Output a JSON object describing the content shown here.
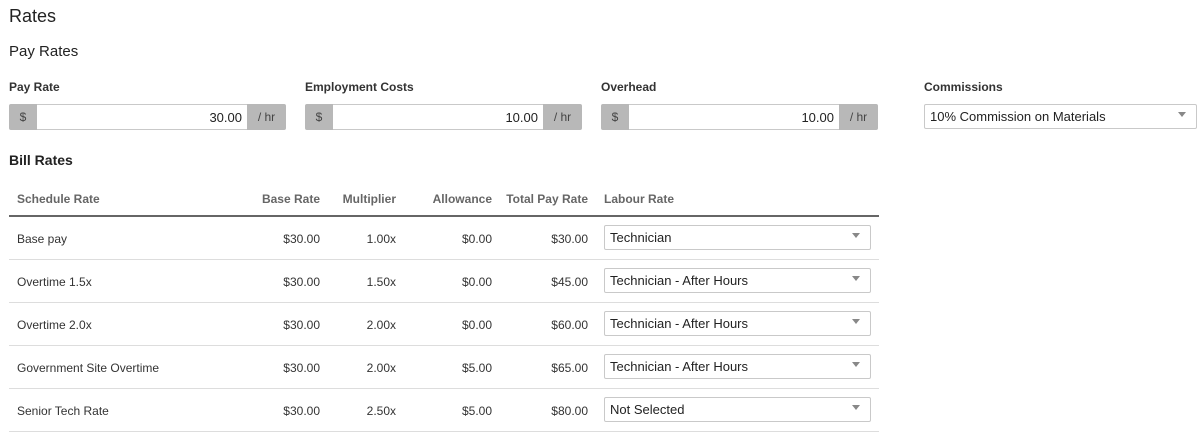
{
  "page": {
    "title": "Rates"
  },
  "pay_rates": {
    "heading": "Pay Rates",
    "pay_rate": {
      "label": "Pay Rate",
      "prefix": "$",
      "value": "30.00",
      "suffix": "/ hr"
    },
    "employment_costs": {
      "label": "Employment Costs",
      "prefix": "$",
      "value": "10.00",
      "suffix": "/ hr"
    },
    "overhead": {
      "label": "Overhead",
      "prefix": "$",
      "value": "10.00",
      "suffix": "/ hr"
    },
    "commissions": {
      "label": "Commissions",
      "selected": "10% Commission on Materials"
    }
  },
  "bill_rates": {
    "heading": "Bill Rates",
    "columns": {
      "schedule_rate": "Schedule Rate",
      "base_rate": "Base Rate",
      "multiplier": "Multiplier",
      "allowance": "Allowance",
      "total_pay_rate": "Total Pay Rate",
      "labour_rate": "Labour Rate"
    },
    "rows": [
      {
        "schedule_rate": "Base pay",
        "base_rate": "$30.00",
        "multiplier": "1.00x",
        "allowance": "$0.00",
        "total_pay_rate": "$30.00",
        "labour_rate": "Technician"
      },
      {
        "schedule_rate": "Overtime 1.5x",
        "base_rate": "$30.00",
        "multiplier": "1.50x",
        "allowance": "$0.00",
        "total_pay_rate": "$45.00",
        "labour_rate": "Technician - After Hours"
      },
      {
        "schedule_rate": "Overtime 2.0x",
        "base_rate": "$30.00",
        "multiplier": "2.00x",
        "allowance": "$0.00",
        "total_pay_rate": "$60.00",
        "labour_rate": "Technician - After Hours"
      },
      {
        "schedule_rate": "Government Site Overtime",
        "base_rate": "$30.00",
        "multiplier": "2.00x",
        "allowance": "$5.00",
        "total_pay_rate": "$65.00",
        "labour_rate": "Technician - After Hours"
      },
      {
        "schedule_rate": "Senior Tech Rate",
        "base_rate": "$30.00",
        "multiplier": "2.50x",
        "allowance": "$5.00",
        "total_pay_rate": "$80.00",
        "labour_rate": "Not Selected"
      }
    ]
  },
  "icons": {
    "dropdown": "chevron-down-icon"
  }
}
